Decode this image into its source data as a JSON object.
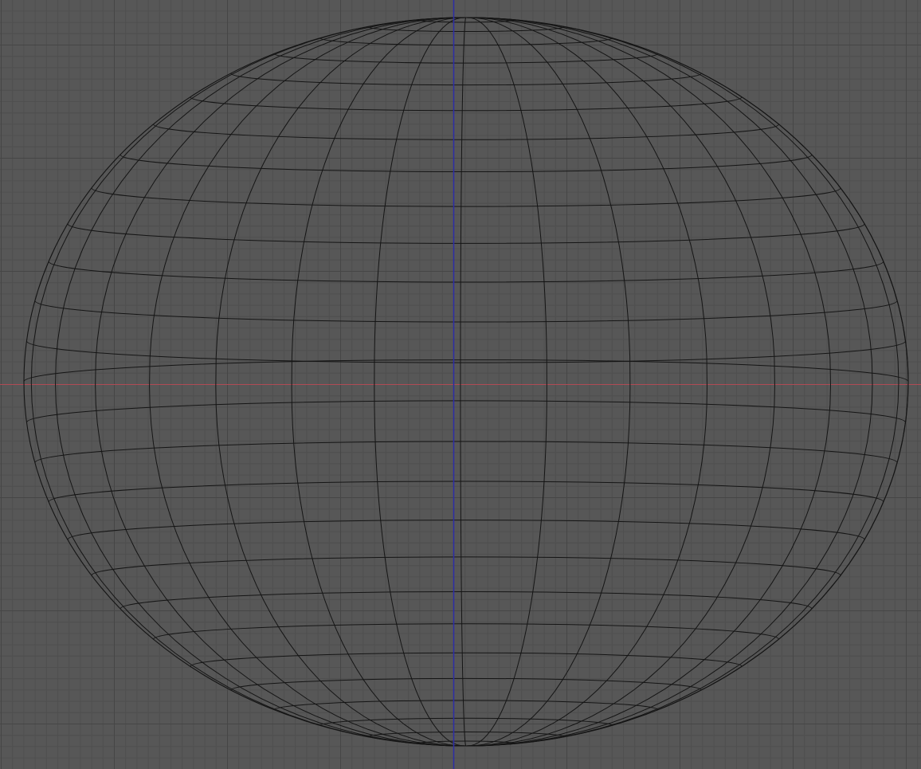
{
  "viewport": {
    "view": "orthographic-front",
    "background_color": "#575757",
    "grid": {
      "visible": true,
      "minor_color": "#4f4f4f",
      "major_color": "#464646"
    },
    "axes": {
      "x_axis_color": "#b04a54",
      "z_axis_color": "#2c2ca6"
    },
    "object": {
      "type": "uv-sphere-wireframe",
      "wire_color": "#151515"
    }
  }
}
